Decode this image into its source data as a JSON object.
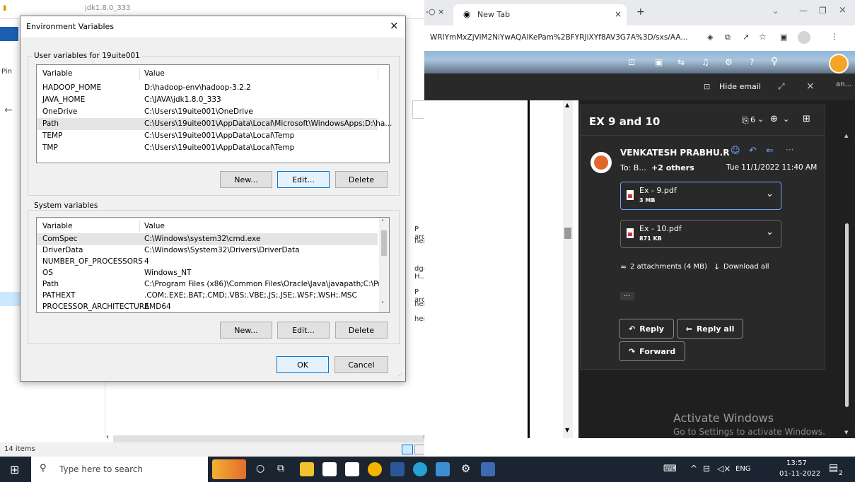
{
  "explorer": {
    "title": "jdk1.8.0_333",
    "status_items": "14 items",
    "pin_label": "Pin",
    "side_snippets": [
      "P archiv",
      "hent",
      "dge H...",
      "P archiv",
      "hent",
      "hent"
    ]
  },
  "browser": {
    "tab_title": "New Tab",
    "address": "WRlYmMxZjViM2NiYwAQAIKePam%2BFYRJiXYf8AV3G7A%3D/sxs/AA...",
    "hide_email": "Hide email",
    "right_edge_text": "an...",
    "email": {
      "subject": "EX 9 and 10",
      "attach_count": "6",
      "sender": "VENKATESH PRABHU.R",
      "to": "To: B...",
      "others": "+2 others",
      "date": "Tue 11/1/2022 11:40 AM",
      "attachments": [
        {
          "name": "Ex - 9.pdf",
          "size": "3 MB"
        },
        {
          "name": "Ex - 10.pdf",
          "size": "871 KB"
        }
      ],
      "attachments_summary": "2 attachments (4 MB)",
      "download_all": "Download all",
      "ellipsis": "...",
      "reply": "Reply",
      "reply_all": "Reply all",
      "forward": "Forward"
    },
    "watermark_title": "Activate Windows",
    "watermark_sub": "Go to Settings to activate Windows."
  },
  "dialog": {
    "title": "Environment Variables",
    "user_group": "User variables for 19uite001",
    "system_group": "System variables",
    "col_variable": "Variable",
    "col_value": "Value",
    "user_vars": [
      {
        "name": "HADOOP_HOME",
        "value": "D:\\hadoop-env\\hadoop-3.2.2"
      },
      {
        "name": "JAVA_HOME",
        "value": "C:\\JAVA\\jdk1.8.0_333"
      },
      {
        "name": "OneDrive",
        "value": "C:\\Users\\19uite001\\OneDrive"
      },
      {
        "name": "Path",
        "value": "C:\\Users\\19uite001\\AppData\\Local\\Microsoft\\WindowsApps;D:\\ha..."
      },
      {
        "name": "TEMP",
        "value": "C:\\Users\\19uite001\\AppData\\Local\\Temp"
      },
      {
        "name": "TMP",
        "value": "C:\\Users\\19uite001\\AppData\\Local\\Temp"
      }
    ],
    "system_vars": [
      {
        "name": "ComSpec",
        "value": "C:\\Windows\\system32\\cmd.exe"
      },
      {
        "name": "DriverData",
        "value": "C:\\Windows\\System32\\Drivers\\DriverData"
      },
      {
        "name": "NUMBER_OF_PROCESSORS",
        "value": "4"
      },
      {
        "name": "OS",
        "value": "Windows_NT"
      },
      {
        "name": "Path",
        "value": "C:\\Program Files (x86)\\Common Files\\Oracle\\Java\\javapath;C:\\Pro..."
      },
      {
        "name": "PATHEXT",
        "value": ".COM;.EXE;.BAT;.CMD;.VBS;.VBE;.JS;.JSE;.WSF;.WSH;.MSC"
      },
      {
        "name": "PROCESSOR_ARCHITECTURE",
        "value": "AMD64"
      }
    ],
    "new_label": "New...",
    "edit_label": "Edit...",
    "delete_label": "Delete",
    "ok_label": "OK",
    "cancel_label": "Cancel"
  },
  "taskbar": {
    "search_placeholder": "Type here to search",
    "time": "13:57",
    "date": "01-11-2022",
    "lang": "ENG",
    "notif_count": "2"
  }
}
